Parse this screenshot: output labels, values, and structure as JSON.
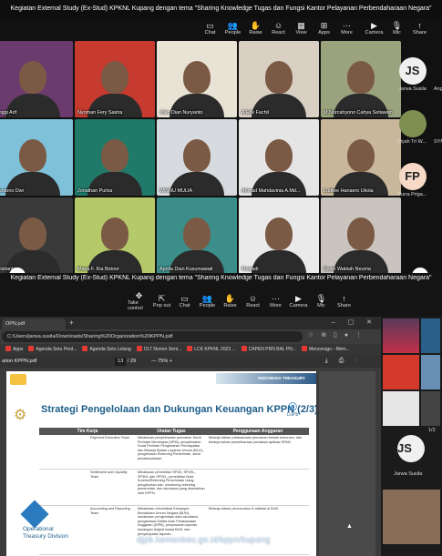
{
  "meeting_top": {
    "title": "Kegiatan External Study (Ex-Stud) KPKNL Kupang dengan tema \"Sharing Knowledge Tugas dan Fungsi Kantor Pelayanan Perbendaharaan Negara\"",
    "toolbar": [
      {
        "label": "Chat",
        "icon": "chat-icon"
      },
      {
        "label": "People",
        "icon": "people-icon"
      },
      {
        "label": "Raise",
        "icon": "raise-hand-icon"
      },
      {
        "label": "React",
        "icon": "react-icon"
      },
      {
        "label": "View",
        "icon": "view-icon"
      },
      {
        "label": "Apps",
        "icon": "apps-icon"
      },
      {
        "label": "More",
        "icon": "more-icon"
      }
    ],
    "toolbar_right": [
      {
        "label": "Camera",
        "icon": "camera-icon"
      },
      {
        "label": "Mic",
        "icon": "mic-icon"
      },
      {
        "label": "Share",
        "icon": "share-icon"
      }
    ],
    "participants": [
      "Anggi Arif",
      "Nyoman Fery Sastra",
      "Joko Dian Nuryanto",
      "A Erik Fachil",
      "M.Nurcahyono Cahya Setiawan",
      "Sunarno Dwi",
      "Jonathan Purba",
      "WISNU MULIA",
      "Ahmad Mahdavinia A.Md...",
      "Ludiwe Hanaero Ukola",
      "Kristianto...",
      "Maria F. Kia Botoor",
      "Aprilia Dian Kusumawati",
      "Mulyadi",
      "Eyael Wabiah Neuma"
    ],
    "sidebar": [
      {
        "initials": "JS",
        "name": "Jarwa Susila",
        "color": "#f0f0f0"
      },
      {
        "initials": "",
        "name": "Dyah Tri W...",
        "color": "#7e8f52"
      },
      {
        "initials": "FP",
        "name": "Furra Priga...",
        "color": "#f7d9c8"
      }
    ],
    "sidebar_partial": [
      "Angi",
      "SYM"
    ]
  },
  "meeting_bottom": {
    "title": "Kegiatan External Study (Ex-Stud) KPKNL Kupang dengan tema \"Sharing Knowledge Tugas dan Fungsi Kantor Pelayanan Perbendaharaan Negara\"",
    "toolbar": [
      {
        "label": "Take control",
        "icon": "take-control-icon"
      },
      {
        "label": "Pop out",
        "icon": "pop-out-icon"
      },
      {
        "label": "Chat",
        "icon": "chat-icon"
      },
      {
        "label": "People",
        "icon": "people-icon"
      },
      {
        "label": "Raise",
        "icon": "raise-hand-icon"
      },
      {
        "label": "React",
        "icon": "react-icon"
      },
      {
        "label": "More",
        "icon": "more-icon"
      },
      {
        "label": "Camera",
        "icon": "camera-icon"
      },
      {
        "label": "Mic",
        "icon": "mic-icon"
      },
      {
        "label": "Share",
        "icon": "share-icon"
      }
    ]
  },
  "browser": {
    "tab_title": "OPN.pdf",
    "url": "C:/Users/jarwa.susila/Downloads/Sharing%20Organization%20KPPN.pdf",
    "bookmarks": [
      "Apps",
      "Agenda Setu Perd...",
      "Agenda Setu Lelang",
      "OLT Nomor Sent...",
      "LCK KPKNL 2023 ...",
      "CAPEN PRN BAL PN...",
      "Mencerago - Mem..."
    ],
    "pdf_name": "ation KPPN.pdf",
    "page_current": "13",
    "page_total": "/ 29",
    "zoom": "75%"
  },
  "slide": {
    "header_band": "INDONESIA TREASURY",
    "title": "Strategi Pengelolaan dan Dukungan Keuangan KPPN (2/3)",
    "djpb": "DJPb",
    "columns": [
      "Tim Kerja",
      "Uraian Tugas",
      "Penggunaan Anggaran"
    ],
    "rows": [
      [
        "Payment Execution Team",
        "Melakukan penyelesaian pencairan Surat Perintah Membayar (SPM), penyelesaian Surat Perintah Pengesahan Pendapatan dan Belanja Badan Layanan Umum (BLU), pengelolaan Rekening Pemerintah, serta penatausahaan.",
        "Belanja bahan pelaksanaan pencairan berkas dokumen, dan belanja bahan pemeliharaan peralatan aplikasi SPAN."
      ],
      [
        "Settlement and Liquidity Team",
        "Melakukan penerbitan SP2D, SP2HL, SP3HL dan SP2KL, penerbitan Nota Koreksi/Rekening Penerimaan Uang, pengelolaan kas, monitoring rekening pemerintah, dan akuntansi yang diserahkan oleh KPPN.",
        ""
      ],
      [
        "Accounting and Reporting Team",
        "Melakukan rekonsiliasi Keuangan Bendahara Umum Negara (BUN), melakukan pengelolaan data akuntansi, pengelolaan Daftar Isian Pelaksanaan Anggaran (DIPA), penyusunan laporan keuangan tingkat kuasa BUN, dan penyampaian laporan.",
        "Belanja bahan pencocokan & validasi di BUN"
      ]
    ],
    "division": "Operational Treasury Division",
    "watermark": "djpb.kemenkeu.go.id/kppn/kupang"
  },
  "right_column": {
    "initials": "JS",
    "name": "Jarwa Susila",
    "pager": "1/2"
  }
}
